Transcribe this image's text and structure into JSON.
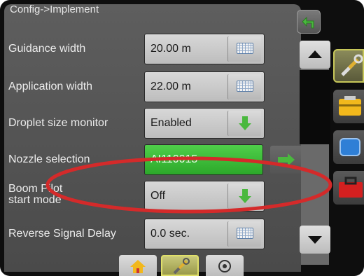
{
  "header": {
    "breadcrumb": "Config->Implement"
  },
  "rows": [
    {
      "label": "Guidance width",
      "value": "20.00 m",
      "control": "keyboard-icon"
    },
    {
      "label": "Application width",
      "value": "22.00 m",
      "control": "keyboard-icon"
    },
    {
      "label": "Droplet size monitor",
      "value": "Enabled",
      "control": "down-arrow-icon"
    },
    {
      "label": "Nozzle selection",
      "value": "AI110015",
      "control": "right-arrow-icon"
    },
    {
      "label_line1": "Boom Pilot",
      "label_line2": "start mode",
      "value": "Off",
      "control": "down-arrow-icon"
    },
    {
      "label": "Reverse Signal Delay",
      "value": "0.0 sec.",
      "control": "keyboard-icon"
    }
  ],
  "side_tabs": [
    "tools-icon",
    "implement-icon",
    "display-icon",
    "toolbox-icon"
  ],
  "bottom_tabs": [
    "home-icon",
    "tools-icon",
    "gps-icon"
  ],
  "colors": {
    "panel": "#555555",
    "field": "#c9c9c9",
    "green_field": "#3cbc38",
    "green_arrow": "#4ab83e",
    "highlight_ellipse": "#d42a2a"
  }
}
